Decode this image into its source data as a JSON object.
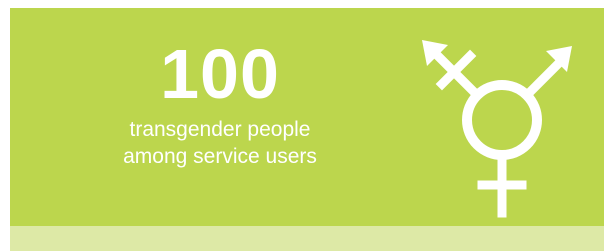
{
  "stat": {
    "number": "100",
    "line1": "transgender people",
    "line2": "among service users"
  },
  "symbol": {
    "icon": "transgender-symbol-icon"
  },
  "colors": {
    "panel": "#bcd64d",
    "strip": "#dde9a6",
    "text": "#ffffff"
  }
}
